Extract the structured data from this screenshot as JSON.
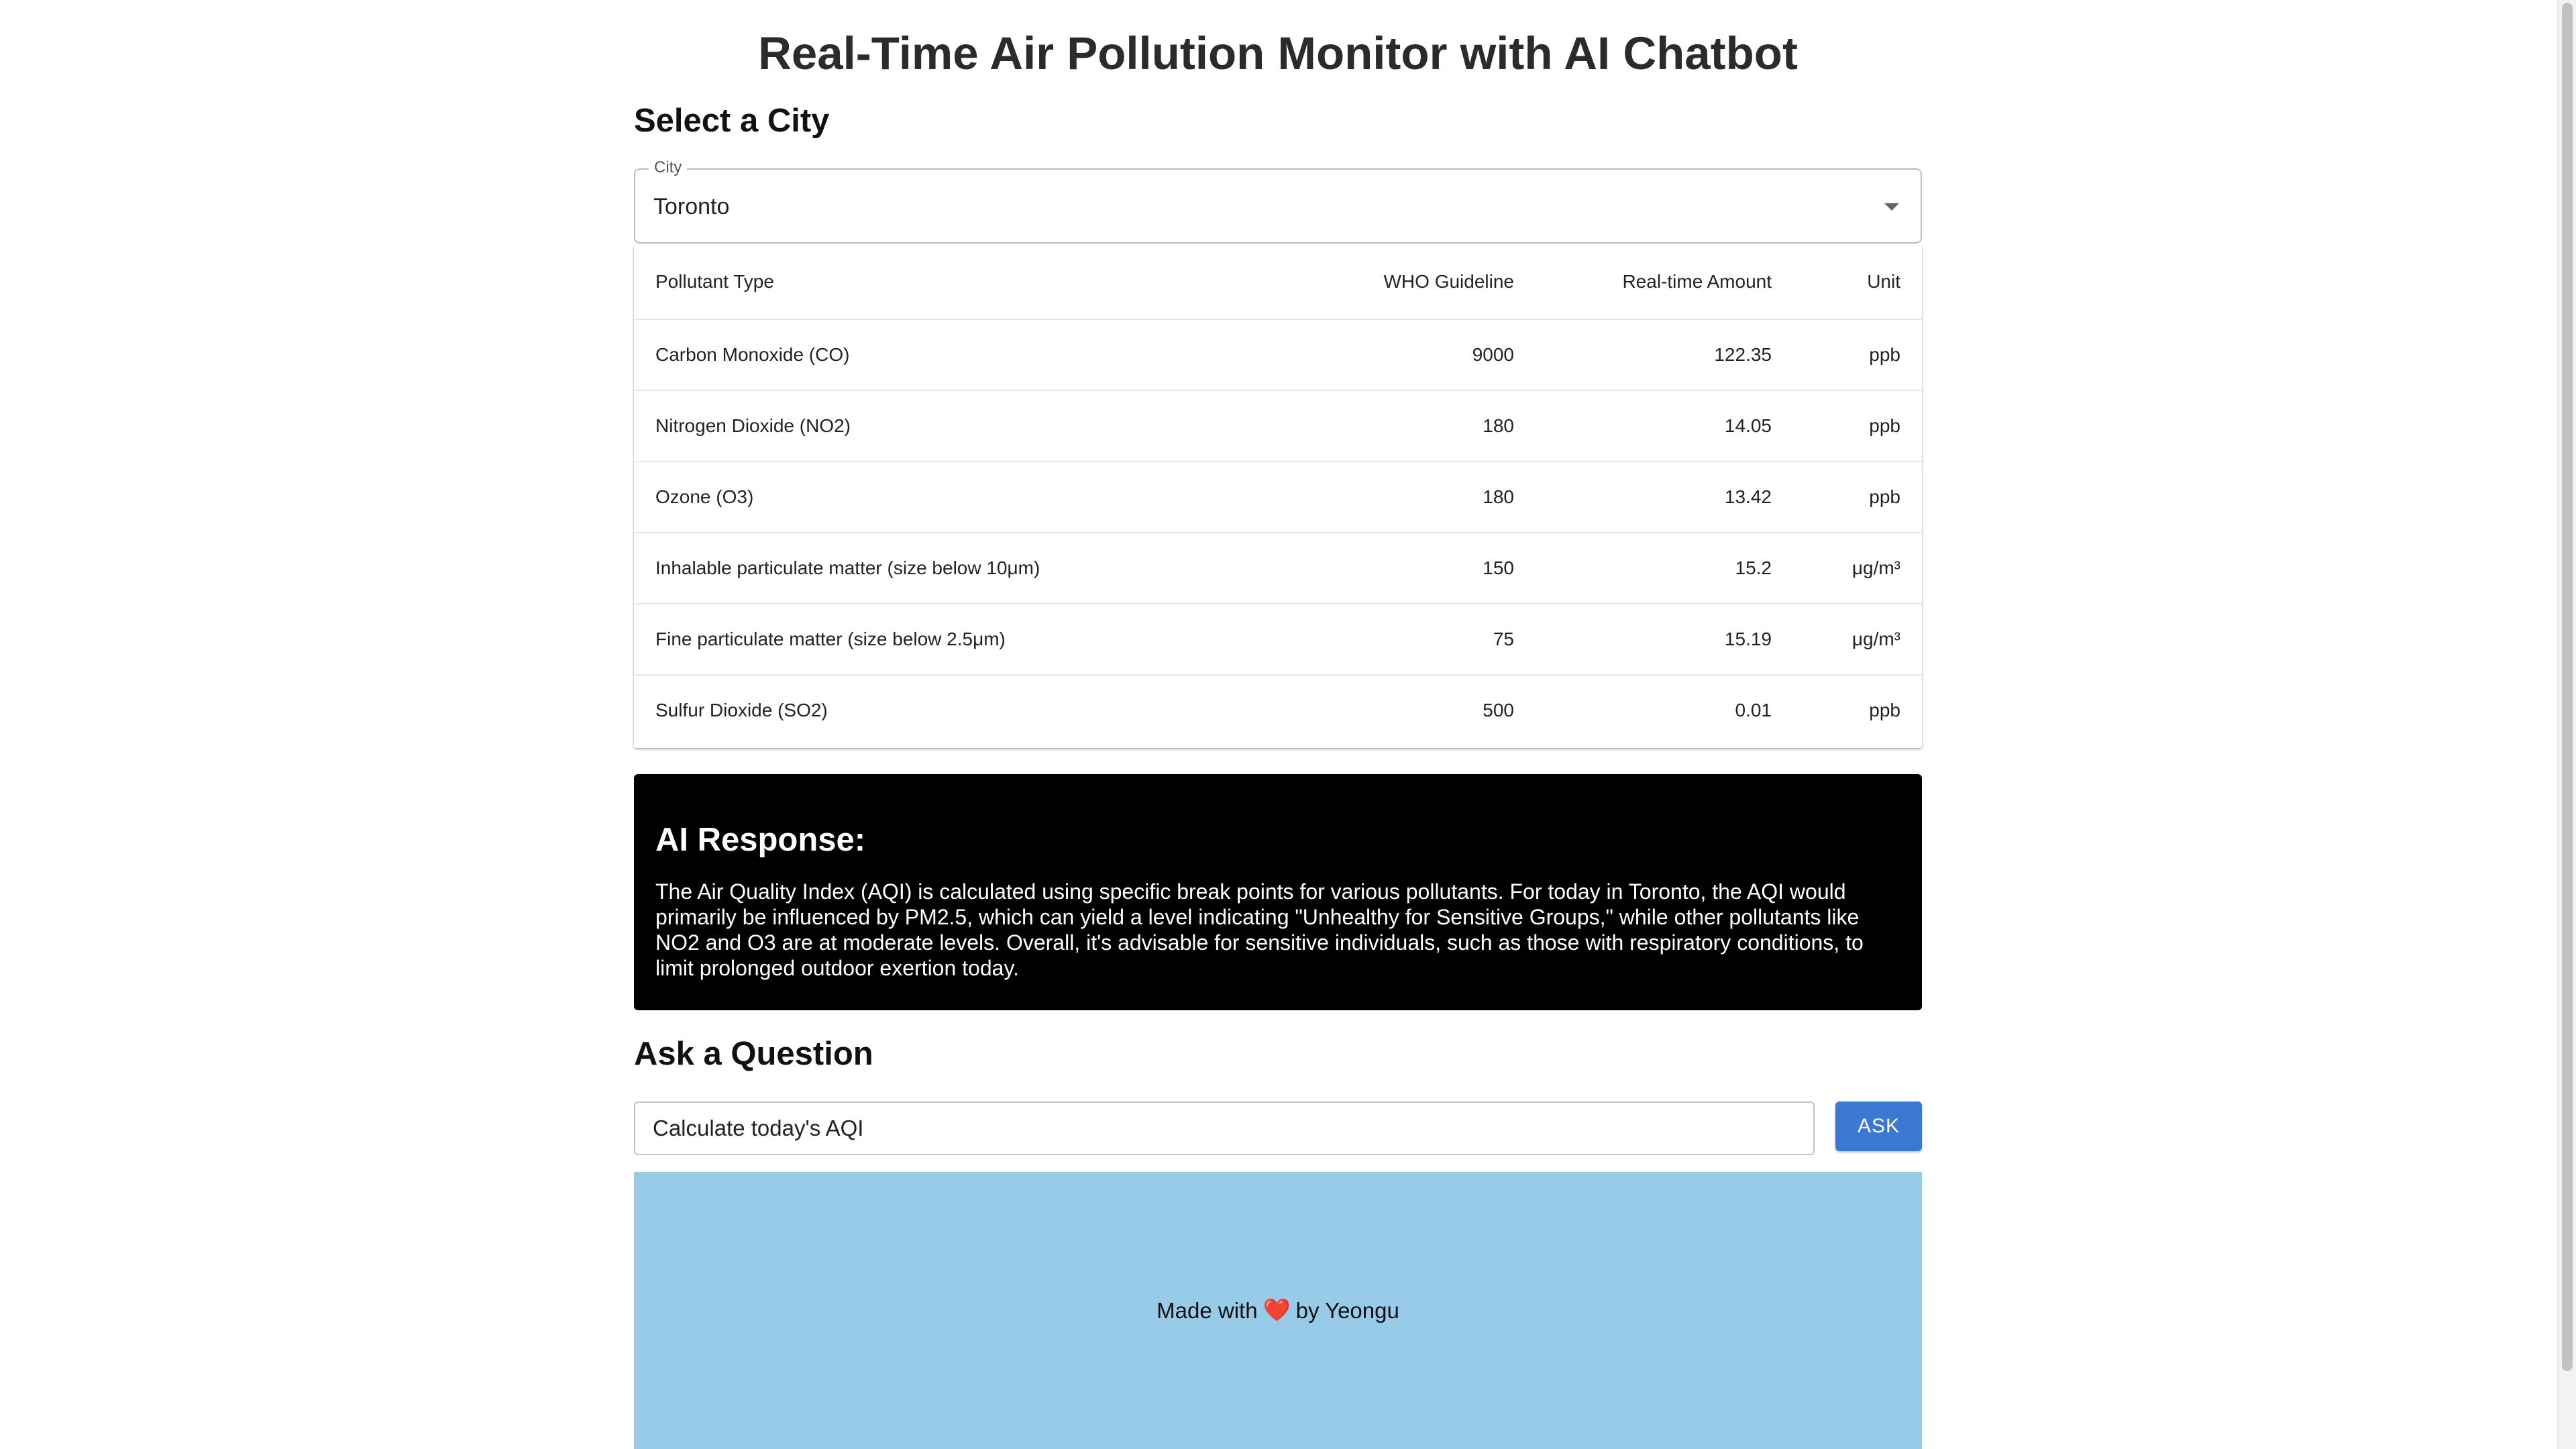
{
  "header": {
    "title": "Real-Time Air Pollution Monitor with AI Chatbot"
  },
  "city_section": {
    "heading": "Select a City",
    "field_label": "City",
    "selected_value": "Toronto"
  },
  "pollutant_table": {
    "columns": [
      "Pollutant Type",
      "WHO Guideline",
      "Real-time Amount",
      "Unit"
    ],
    "rows": [
      {
        "type": "Carbon Monoxide (CO)",
        "who": "9000",
        "realtime": "122.35",
        "unit": "ppb"
      },
      {
        "type": "Nitrogen Dioxide (NO2)",
        "who": "180",
        "realtime": "14.05",
        "unit": "ppb"
      },
      {
        "type": "Ozone (O3)",
        "who": "180",
        "realtime": "13.42",
        "unit": "ppb"
      },
      {
        "type": "Inhalable particulate matter (size below 10μm)",
        "who": "150",
        "realtime": "15.2",
        "unit": "μg/m³"
      },
      {
        "type": "Fine particulate matter (size below 2.5μm)",
        "who": "75",
        "realtime": "15.19",
        "unit": "μg/m³"
      },
      {
        "type": "Sulfur Dioxide (SO2)",
        "who": "500",
        "realtime": "0.01",
        "unit": "ppb"
      }
    ]
  },
  "ai_response": {
    "heading": "AI Response:",
    "text": "The Air Quality Index (AQI) is calculated using specific break points for various pollutants. For today in Toronto, the AQI would primarily be influenced by PM2.5, which can yield a level indicating \"Unhealthy for Sensitive Groups,\" while other pollutants like NO2 and O3 are at moderate levels. Overall, it's advisable for sensitive individuals, such as those with respiratory conditions, to limit prolonged outdoor exertion today."
  },
  "ask_section": {
    "heading": "Ask a Question",
    "input_value": "Calculate today's AQI",
    "button_label": "ASK"
  },
  "footer": {
    "prefix": "Made with",
    "heart_icon": "heart-icon",
    "suffix": "by Yeongu"
  },
  "colors": {
    "ask_button": "#3a78d4",
    "footer_background": "#98cbe8",
    "ai_box_background": "#000000"
  }
}
